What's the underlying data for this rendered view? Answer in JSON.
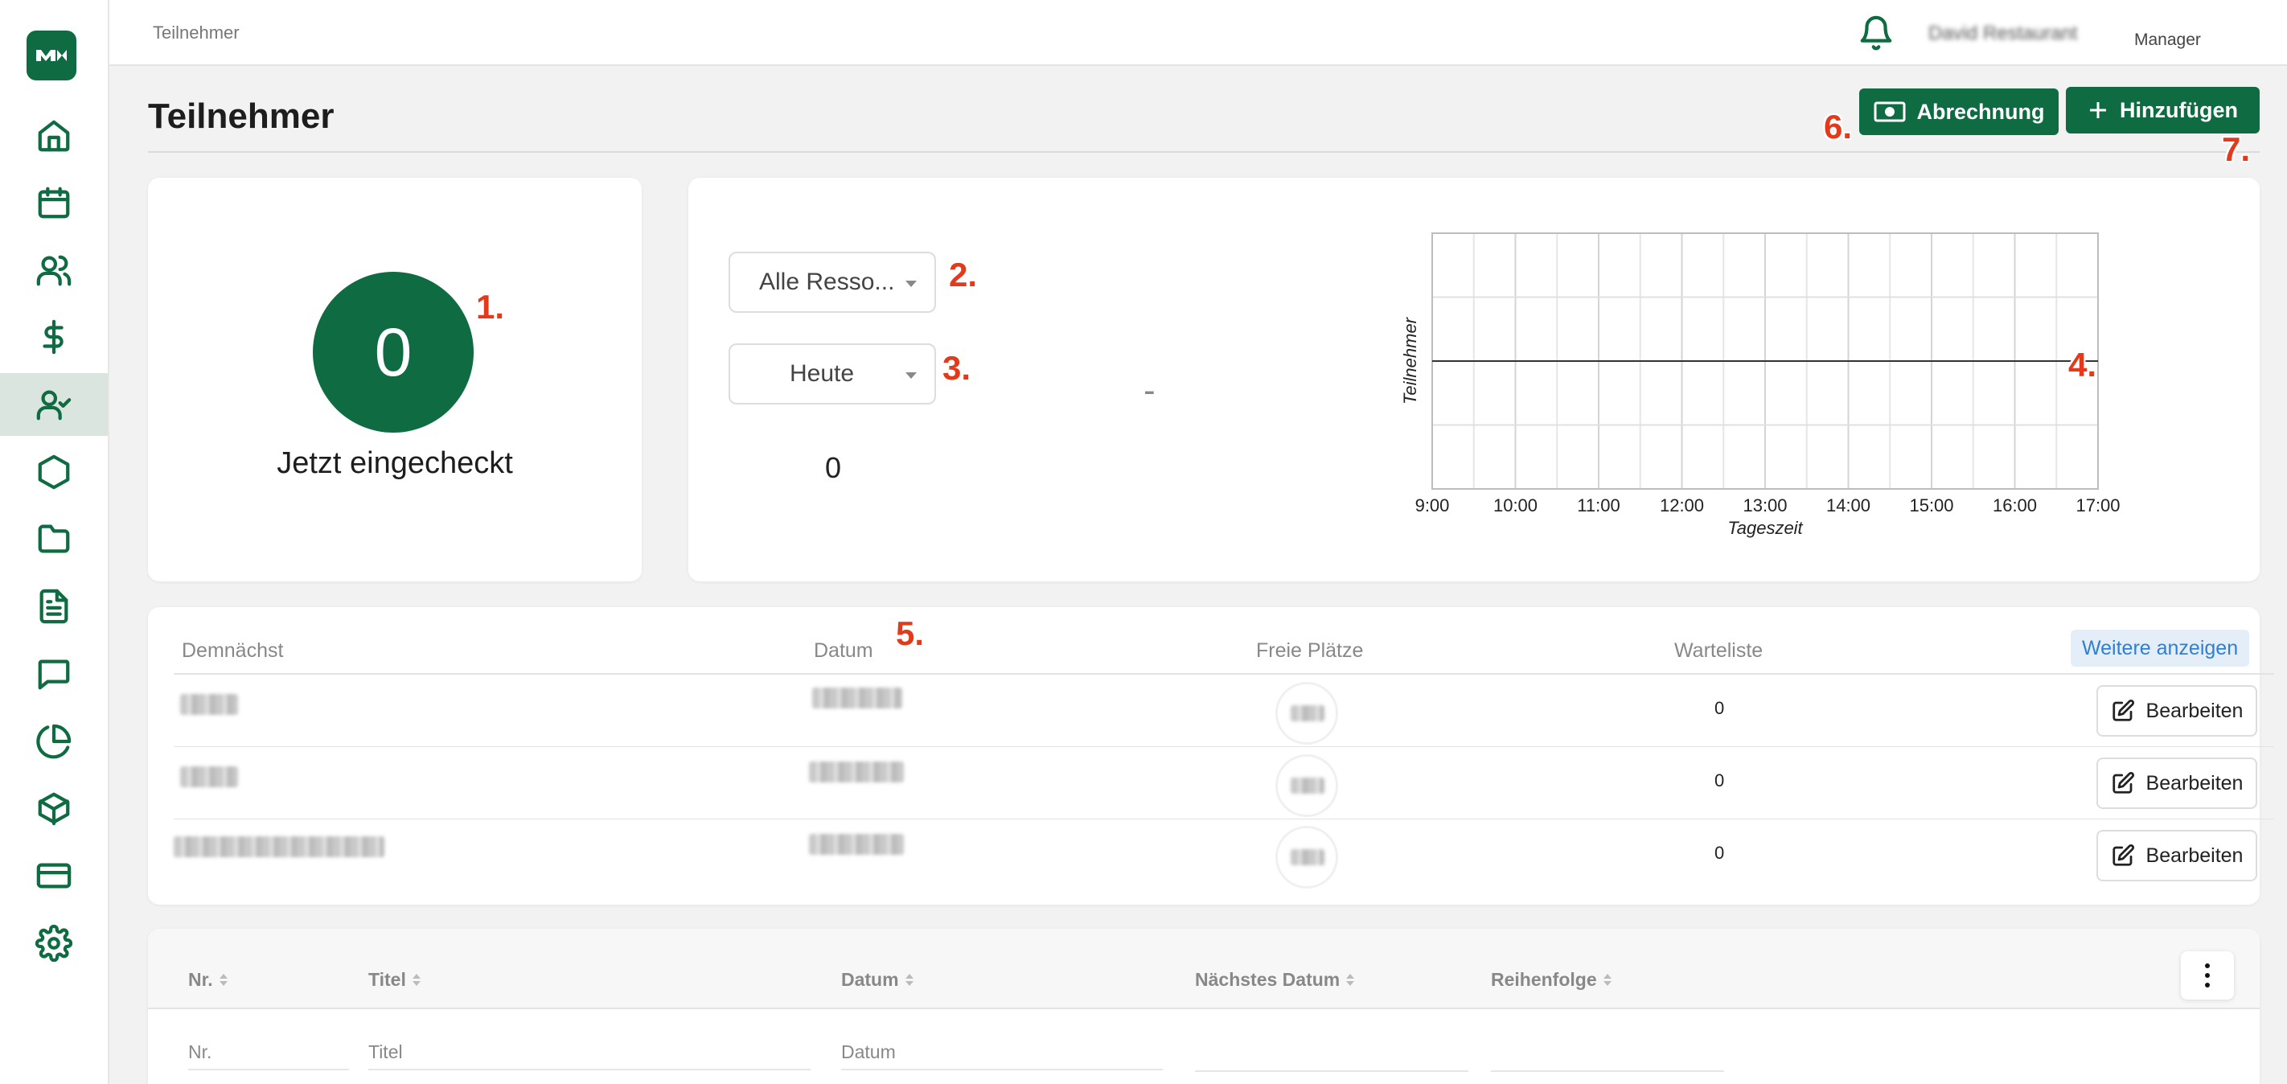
{
  "header": {
    "breadcrumb": "Teilnehmer",
    "user_name": "David Restaurant",
    "user_role": "Manager"
  },
  "sidebar": {
    "items": [
      {
        "icon": "home-icon"
      },
      {
        "icon": "calendar-icon"
      },
      {
        "icon": "users-icon"
      },
      {
        "icon": "dollar-icon"
      },
      {
        "icon": "user-check-icon",
        "active": true
      },
      {
        "icon": "hexagon-icon"
      },
      {
        "icon": "folder-icon"
      },
      {
        "icon": "document-icon"
      },
      {
        "icon": "message-icon"
      },
      {
        "icon": "pie-chart-icon"
      },
      {
        "icon": "box-icon"
      },
      {
        "icon": "credit-card-icon"
      },
      {
        "icon": "settings-icon"
      }
    ]
  },
  "page": {
    "title": "Teilnehmer",
    "billing_button": "Abrechnung",
    "add_button": "Hinzufügen"
  },
  "markers": [
    "1.",
    "2.",
    "3.",
    "4.",
    "5.",
    "6.",
    "7."
  ],
  "checkin": {
    "count": "0",
    "label": "Jetzt eingecheckt"
  },
  "filters": {
    "resource_select": "Alle Resso...",
    "period_select": "Heute",
    "dash": "-",
    "count": "0"
  },
  "chart_data": {
    "type": "line",
    "xlabel": "Tageszeit",
    "ylabel": "Teilnehmer",
    "x_ticks": [
      "9:00",
      "10:00",
      "11:00",
      "12:00",
      "13:00",
      "14:00",
      "15:00",
      "16:00",
      "17:00"
    ],
    "series": [
      {
        "x": [
          "9:00",
          "10:00",
          "11:00",
          "12:00",
          "13:00",
          "14:00",
          "15:00",
          "16:00",
          "17:00"
        ],
        "values": [
          0,
          0,
          0,
          0,
          0,
          0,
          0,
          0,
          0
        ]
      }
    ],
    "grid": true
  },
  "upcoming": {
    "columns": [
      "Demnächst",
      "Datum",
      "Freie Plätze",
      "Warteliste"
    ],
    "more_button": "Weitere anzeigen",
    "edit_label": "Bearbeiten",
    "rows": [
      {
        "waitlist": "0"
      },
      {
        "waitlist": "0"
      },
      {
        "waitlist": "0"
      }
    ]
  },
  "courses": {
    "columns": [
      "Nr.",
      "Titel",
      "Datum",
      "Nächstes Datum",
      "Reihenfolge"
    ],
    "filter_placeholders": {
      "nr": "Nr.",
      "title": "Titel",
      "date": "Datum"
    }
  }
}
